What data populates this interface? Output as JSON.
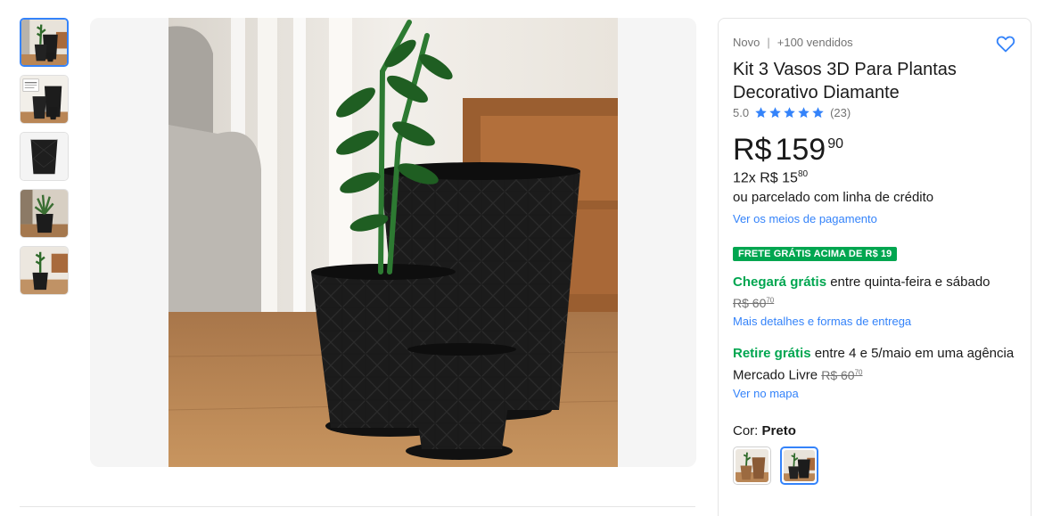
{
  "thumbnails": [
    {
      "name": "thumbnail-1",
      "active": true
    },
    {
      "name": "thumbnail-2",
      "active": false
    },
    {
      "name": "thumbnail-3",
      "active": false
    },
    {
      "name": "thumbnail-4",
      "active": false
    },
    {
      "name": "thumbnail-5",
      "active": false
    }
  ],
  "product": {
    "condition": "Novo",
    "separator": "|",
    "sold": "+100 vendidos",
    "title": "Kit 3 Vasos 3D Para Plantas Decorativo Diamante",
    "rating_value": "5.0",
    "rating_count": "(23)",
    "stars": 5,
    "favorite_icon": "heart-icon"
  },
  "price": {
    "currency": "R$",
    "amount": "159",
    "cents": "90",
    "installments_prefix": "12x R$ 15",
    "installments_cents": "80",
    "credit_text": "ou parcelado com linha de crédito",
    "payment_link": "Ver os meios de pagamento"
  },
  "shipping": {
    "badge": "FRETE GRÁTIS ACIMA DE R$ 19",
    "arrival_highlight": "Chegará grátis",
    "arrival_text": " entre quinta-feira e sábado",
    "old_price": "R$ 60",
    "old_price_cents": "70",
    "details_link": "Mais detalhes e formas de entrega",
    "pickup_highlight": "Retire grátis",
    "pickup_text": " entre 4 e 5/maio em uma agência Mercado Livre ",
    "pickup_old_price": "R$ 60",
    "pickup_old_price_cents": "70",
    "map_link": "Ver no mapa"
  },
  "variant": {
    "label": "Cor: ",
    "selected": "Preto",
    "swatches": [
      "swatch-brown",
      "swatch-black"
    ]
  },
  "colors": {
    "accent": "#3483fa",
    "green": "#00a650",
    "text": "#1a1a1a",
    "muted": "#737373"
  }
}
